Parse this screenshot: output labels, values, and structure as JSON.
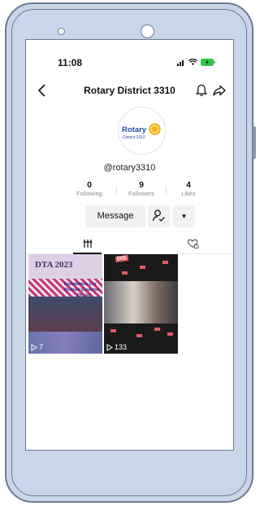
{
  "status_bar": {
    "time": "11:08"
  },
  "header": {
    "title": "Rotary District 3310"
  },
  "avatar": {
    "name": "Rotary",
    "sub": "District 3310"
  },
  "profile": {
    "username": "@rotary3310",
    "stats": [
      {
        "value": "0",
        "label": "Following"
      },
      {
        "value": "9",
        "label": "Followers"
      },
      {
        "value": "4",
        "label": "Likes"
      }
    ]
  },
  "actions": {
    "message_label": "Message"
  },
  "videos": [
    {
      "views": "7",
      "logo": "DTA 2023",
      "line1": "Installation Cer",
      "line2": "District Governo",
      "line3": "Dr. Jol"
    },
    {
      "views": "133",
      "sticker": "DIS",
      "sticker2": "C"
    }
  ],
  "colors": {
    "phone_frame": "#c9d6ea",
    "rotary_blue": "#1f4e9c",
    "rotary_gold": "#f3b41a",
    "battery_green": "#2fc64a"
  }
}
